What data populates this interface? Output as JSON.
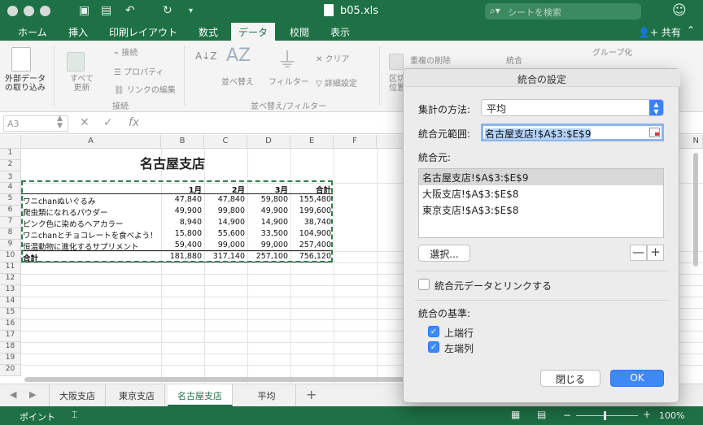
{
  "window": {
    "file_name": "b05.xls",
    "search_placeholder": "シートを検索"
  },
  "ribbon_tabs": [
    "ホーム",
    "挿入",
    "印刷レイアウト",
    "数式",
    "データ",
    "校閲",
    "表示"
  ],
  "active_tab": "データ",
  "share_label": "共有",
  "ribbon": {
    "external_data": "外部データ\nの取り込み",
    "refresh_all": "すべて\n更新",
    "connections": "接続",
    "properties": "プロパティ",
    "edit_links": "リンクの編集",
    "group_connections": "接続",
    "sort": "並べ替え",
    "filter": "フィルター",
    "clear": "クリア",
    "advanced": "詳細設定",
    "group_sort_filter": "並べ替え/フィルター",
    "text_to_columns": "区切\n位置",
    "remove_duplicates": "重複の削除",
    "consolidate": "統合",
    "group": "グループ化",
    "sort_icon_label": "AZ"
  },
  "formula_bar": {
    "cell_ref": "A3",
    "fx": "fx"
  },
  "columns": [
    "A",
    "B",
    "C",
    "D",
    "E",
    "F",
    "N"
  ],
  "rows": [
    "1",
    "2",
    "3",
    "4",
    "5",
    "6",
    "7",
    "8",
    "9",
    "10",
    "11",
    "12",
    "13",
    "14",
    "15",
    "16",
    "17",
    "18",
    "19",
    "20"
  ],
  "sheet": {
    "title": "名古屋支店",
    "headers": [
      "1月",
      "2月",
      "3月",
      "合計"
    ],
    "data_rows": [
      {
        "label": "ワニchanぬいぐるみ",
        "values": [
          "47,840",
          "47,840",
          "59,800",
          "155,480"
        ]
      },
      {
        "label": "爬虫類になれるパウダー",
        "values": [
          "49,900",
          "99,800",
          "49,900",
          "199,600"
        ]
      },
      {
        "label": "ピンク色に染めるヘアカラー",
        "values": [
          "8,940",
          "14,900",
          "14,900",
          "38,740"
        ]
      },
      {
        "label": "ワニchanとチョコレートを食べよう！",
        "values": [
          "15,800",
          "55,600",
          "33,500",
          "104,900"
        ]
      },
      {
        "label": "恒温動物に進化するサプリメント",
        "values": [
          "59,400",
          "99,000",
          "99,000",
          "257,400"
        ]
      }
    ],
    "total_row": {
      "label": "合計",
      "values": [
        "181,880",
        "317,140",
        "257,100",
        "756,120"
      ]
    }
  },
  "sheet_tabs": [
    "大阪支店",
    "東京支店",
    "名古屋支店",
    "平均"
  ],
  "active_sheet": "名古屋支店",
  "status": {
    "mode": "ポイント",
    "zoom": "100%"
  },
  "dialog": {
    "title": "統合の設定",
    "function_label": "集計の方法:",
    "function_value": "平均",
    "ref_label": "統合元範囲:",
    "ref_value": "名古屋支店!$A$3:$E$9",
    "sources_label": "統合元:",
    "sources": [
      "名古屋支店!$A$3:$E$9",
      "大阪支店!$A$3:$E$8",
      "東京支店!$A$3:$E$8"
    ],
    "browse_label": "選択...",
    "link_label": "統合元データとリンクする",
    "basis_label": "統合の基準:",
    "top_row_label": "上端行",
    "left_col_label": "左端列",
    "close_label": "閉じる",
    "ok_label": "OK",
    "minus": "—",
    "plus": "+"
  },
  "colors": {
    "excel_green": "#1e7145",
    "accent_blue": "#3d8af7"
  }
}
